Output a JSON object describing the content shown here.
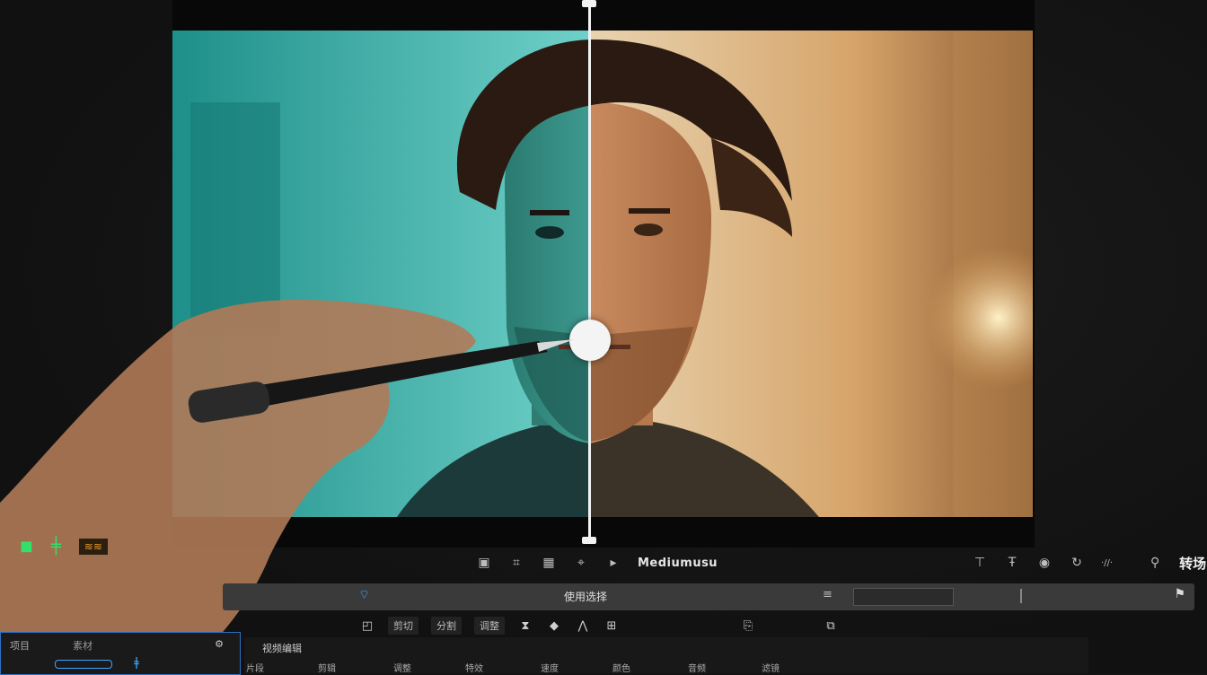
{
  "toolbar": {
    "title": "Mediumusu",
    "right_label": "转场",
    "tiny_readout": "·//·"
  },
  "timeline": {
    "center_label": "使用选择"
  },
  "controls": {
    "fields": [
      "剪切",
      "分割",
      "调整"
    ]
  },
  "panel_left": {
    "label_1": "项目",
    "label_2": "素材"
  },
  "panel_main": {
    "header": "视频编辑",
    "columns": [
      "片段",
      "剪辑",
      "调整",
      "特效",
      "速度",
      "颜色",
      "音频",
      "滤镜"
    ]
  },
  "colors": {
    "teal": "#2bb8ae",
    "warm": "#d89a55",
    "accent_blue": "#3fa3ff",
    "accent_green": "#35e06a",
    "accent_orange": "#e8962a"
  },
  "icons": {
    "left_status": [
      "green-camera-icon",
      "green-marker-icon",
      "orange-effect-icon"
    ],
    "toolbar": [
      "film-icon",
      "crop-icon",
      "grid-icon",
      "mask-icon",
      "play-icon"
    ],
    "toolbar_right": [
      "text-icon",
      "pin-icon",
      "settings-icon",
      "refresh-icon",
      "search-icon"
    ]
  }
}
